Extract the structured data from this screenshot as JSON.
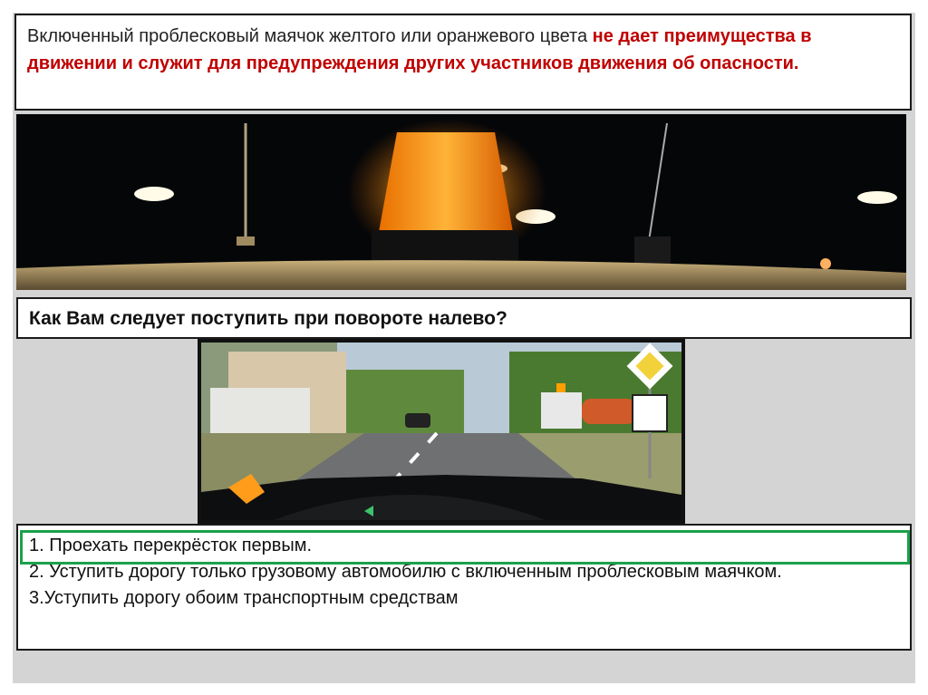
{
  "intro": {
    "part1": "Включенный проблесковый маячок желтого или оранжевого цвета ",
    "part2": "не дает преимущества в движении и служит для предупреждения других участников ",
    "part3": "движения об опасности."
  },
  "question": "Как Вам следует поступить при повороте налево?",
  "answers": [
    "1. Проехать перекрёсток первым.",
    "2. Уступить дорогу только грузовому автомобилю с включенным проблесковым маячком.",
    "3.Уступить дорогу обоим транспортным средствам"
  ],
  "colors": {
    "highlight_text": "#c00000",
    "correct_answer_frame": "#1aa14b"
  }
}
